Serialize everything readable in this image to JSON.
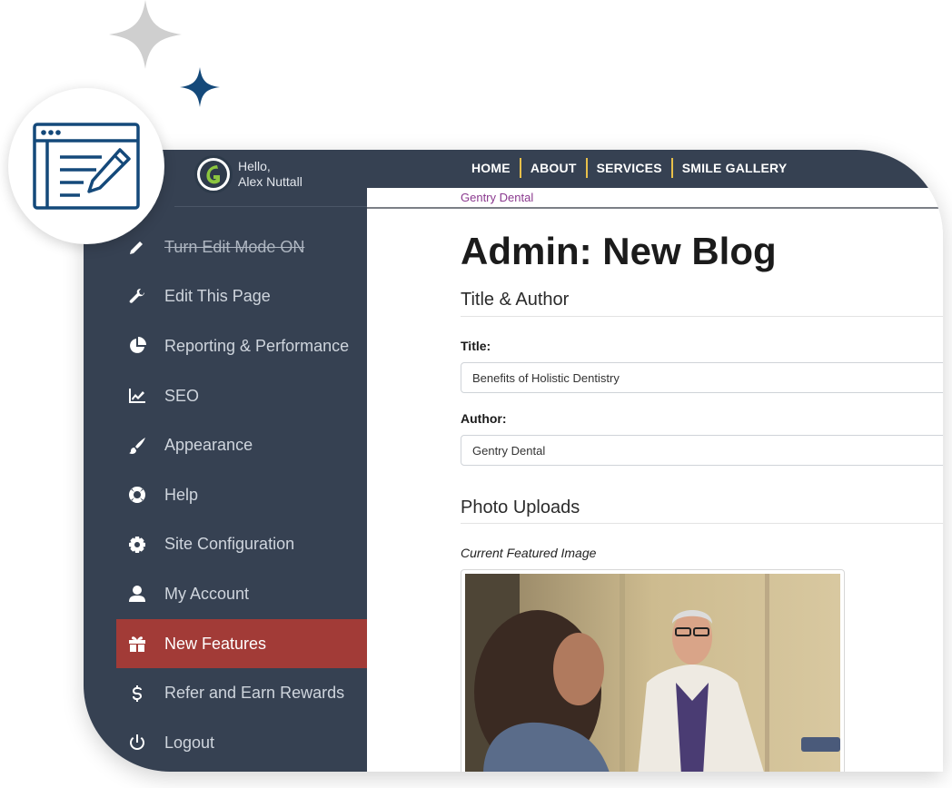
{
  "user": {
    "greeting": "Hello,",
    "name": "Alex Nuttall"
  },
  "sidebar": {
    "items": [
      {
        "label": "Turn Edit Mode ON",
        "icon": "pencil-icon"
      },
      {
        "label": "Edit This Page",
        "icon": "wrench-icon"
      },
      {
        "label": "Reporting & Performance",
        "icon": "pie-chart-icon"
      },
      {
        "label": "SEO",
        "icon": "line-chart-icon"
      },
      {
        "label": "Appearance",
        "icon": "paintbrush-icon"
      },
      {
        "label": "Help",
        "icon": "lifebuoy-icon"
      },
      {
        "label": "Site Configuration",
        "icon": "gear-icon"
      },
      {
        "label": "My Account",
        "icon": "user-icon"
      },
      {
        "label": "New Features",
        "icon": "gift-icon"
      },
      {
        "label": "Refer and Earn Rewards",
        "icon": "dollar-icon"
      },
      {
        "label": "Logout",
        "icon": "power-icon"
      }
    ]
  },
  "topnav": {
    "home": "HOME",
    "about": "ABOUT",
    "services": "SERVICES",
    "smile_gallery": "SMILE GALLERY"
  },
  "content": {
    "breadcrumb": "Gentry Dental",
    "title": "Admin: New Blog",
    "section_title_author": "Title & Author",
    "title_label": "Title:",
    "title_value": "Benefits of Holistic Dentistry",
    "author_label": "Author:",
    "author_value": "Gentry Dental",
    "section_photos": "Photo Uploads",
    "featured_caption": "Current Featured Image"
  },
  "colors": {
    "sidebar_bg": "#364152",
    "active_item": "#a23b37",
    "nav_separator": "#e8c04a",
    "breadcrumb_link": "#8b3a8f",
    "accent_navy": "#14497a"
  }
}
